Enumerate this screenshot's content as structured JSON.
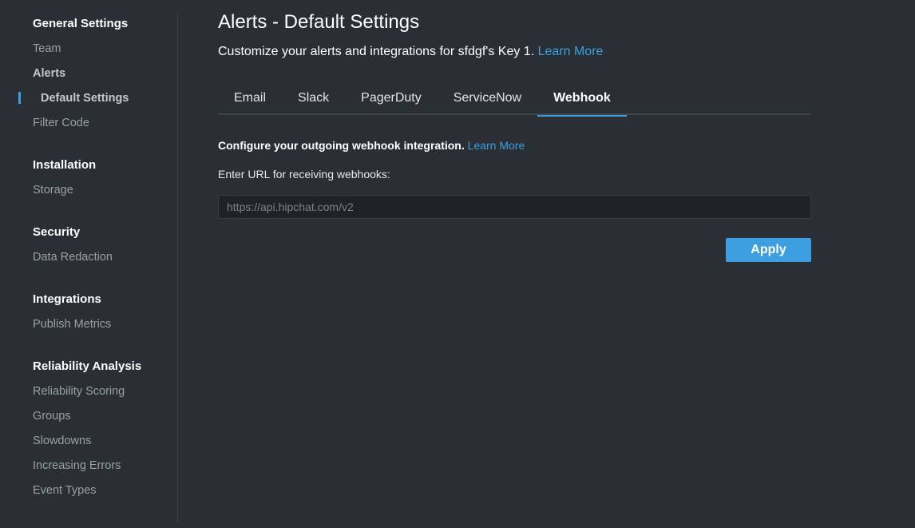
{
  "sidebar": {
    "groups": [
      {
        "title": "General Settings",
        "items": [
          "Team",
          "Alerts",
          "Default Settings",
          "Filter Code"
        ]
      },
      {
        "title": "Installation",
        "items": [
          "Storage"
        ]
      },
      {
        "title": "Security",
        "items": [
          "Data Redaction"
        ]
      },
      {
        "title": "Integrations",
        "items": [
          "Publish Metrics"
        ]
      },
      {
        "title": "Reliability Analysis",
        "items": [
          "Reliability Scoring",
          "Groups",
          "Slowdowns",
          "Increasing Errors",
          "Event Types"
        ]
      }
    ],
    "active_item": "Default Settings"
  },
  "main": {
    "title": "Alerts - Default Settings",
    "subtitle": "Customize your alerts and integrations for sfdgf's Key 1.",
    "subtitle_link": "Learn More",
    "tabs": [
      "Email",
      "Slack",
      "PagerDuty",
      "ServiceNow",
      "Webhook"
    ],
    "active_tab": "Webhook",
    "webhook": {
      "heading": "Configure your outgoing webhook integration.",
      "heading_link": "Learn More",
      "url_label": "Enter URL for receiving webhooks:",
      "url_value": "",
      "url_placeholder": "https://api.hipchat.com/v2",
      "apply_label": "Apply"
    }
  },
  "colors": {
    "background": "#2a2f36",
    "accent": "#3d9fe0",
    "input_background": "#1f2328"
  }
}
